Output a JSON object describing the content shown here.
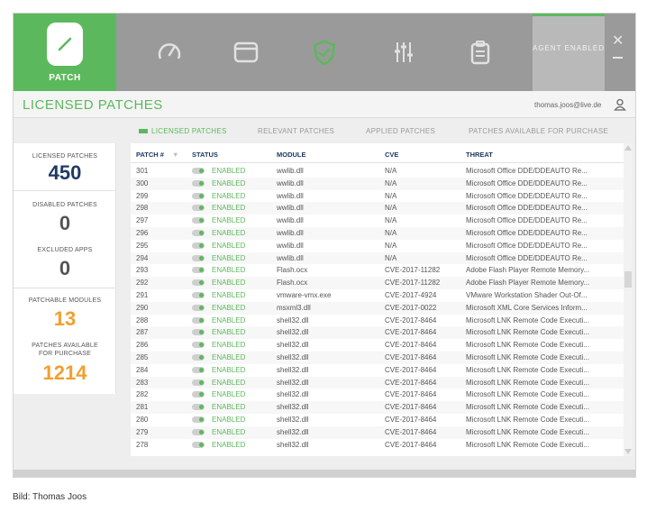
{
  "app": {
    "patch_tab_label": "PATCH",
    "agent_status": "AGENT ENABLED",
    "nav_icons": [
      "gauge-icon",
      "window-icon",
      "shield-check-icon",
      "sliders-icon",
      "clipboard-icon"
    ],
    "accent_color": "#5cb85c"
  },
  "header": {
    "title": "LICENSED PATCHES",
    "user_email": "thomas.joos@live.de"
  },
  "subtabs": [
    "LICENSED PATCHES",
    "RELEVANT PATCHES",
    "APPLIED PATCHES",
    "PATCHES AVAILABLE FOR PURCHASE"
  ],
  "stats": {
    "licensed_patches": {
      "label": "LICENSED PATCHES",
      "value": "450",
      "color": "#1f3a63"
    },
    "disabled_patches": {
      "label": "DISABLED PATCHES",
      "value": "0",
      "color": "#555555"
    },
    "excluded_apps": {
      "label": "EXCLUDED APPS",
      "value": "0",
      "color": "#555555"
    },
    "patchable_modules": {
      "label": "PATCHABLE MODULES",
      "value": "13",
      "color": "#f0a030"
    },
    "patches_for_purchase": {
      "label": "PATCHES AVAILABLE FOR PURCHASE",
      "value": "1214",
      "color": "#f0a030"
    }
  },
  "table": {
    "columns": [
      "PATCH #",
      "STATUS",
      "MODULE",
      "CVE",
      "THREAT"
    ],
    "rows": [
      [
        "301",
        "ENABLED",
        "wwlib.dll",
        "N/A",
        "Microsoft Office DDE/DDEAUTO Re..."
      ],
      [
        "300",
        "ENABLED",
        "wwlib.dll",
        "N/A",
        "Microsoft Office DDE/DDEAUTO Re..."
      ],
      [
        "299",
        "ENABLED",
        "wwlib.dll",
        "N/A",
        "Microsoft Office DDE/DDEAUTO Re..."
      ],
      [
        "298",
        "ENABLED",
        "wwlib.dll",
        "N/A",
        "Microsoft Office DDE/DDEAUTO Re..."
      ],
      [
        "297",
        "ENABLED",
        "wwlib.dll",
        "N/A",
        "Microsoft Office DDE/DDEAUTO Re..."
      ],
      [
        "296",
        "ENABLED",
        "wwlib.dll",
        "N/A",
        "Microsoft Office DDE/DDEAUTO Re..."
      ],
      [
        "295",
        "ENABLED",
        "wwlib.dll",
        "N/A",
        "Microsoft Office DDE/DDEAUTO Re..."
      ],
      [
        "294",
        "ENABLED",
        "wwlib.dll",
        "N/A",
        "Microsoft Office DDE/DDEAUTO Re..."
      ],
      [
        "293",
        "ENABLED",
        "Flash.ocx",
        "CVE-2017-11282",
        "Adobe Flash Player Remote Memory..."
      ],
      [
        "292",
        "ENABLED",
        "Flash.ocx",
        "CVE-2017-11282",
        "Adobe Flash Player Remote Memory..."
      ],
      [
        "291",
        "ENABLED",
        "vmware-vmx.exe",
        "CVE-2017-4924",
        "VMware Workstation Shader Out-Of..."
      ],
      [
        "290",
        "ENABLED",
        "msxml3.dll",
        "CVE-2017-0022",
        "Microsoft XML Core Services Inform..."
      ],
      [
        "288",
        "ENABLED",
        "shell32.dll",
        "CVE-2017-8464",
        "Microsoft LNK Remote Code Executi..."
      ],
      [
        "287",
        "ENABLED",
        "shell32.dll",
        "CVE-2017-8464",
        "Microsoft LNK Remote Code Executi..."
      ],
      [
        "286",
        "ENABLED",
        "shell32.dll",
        "CVE-2017-8464",
        "Microsoft LNK Remote Code Executi..."
      ],
      [
        "285",
        "ENABLED",
        "shell32.dll",
        "CVE-2017-8464",
        "Microsoft LNK Remote Code Executi..."
      ],
      [
        "284",
        "ENABLED",
        "shell32.dll",
        "CVE-2017-8464",
        "Microsoft LNK Remote Code Executi..."
      ],
      [
        "283",
        "ENABLED",
        "shell32.dll",
        "CVE-2017-8464",
        "Microsoft LNK Remote Code Executi..."
      ],
      [
        "282",
        "ENABLED",
        "shell32.dll",
        "CVE-2017-8464",
        "Microsoft LNK Remote Code Executi..."
      ],
      [
        "281",
        "ENABLED",
        "shell32.dll",
        "CVE-2017-8464",
        "Microsoft LNK Remote Code Executi..."
      ],
      [
        "280",
        "ENABLED",
        "shell32.dll",
        "CVE-2017-8464",
        "Microsoft LNK Remote Code Executi..."
      ],
      [
        "279",
        "ENABLED",
        "shell32.dll",
        "CVE-2017-8464",
        "Microsoft LNK Remote Code Executi..."
      ],
      [
        "278",
        "ENABLED",
        "shell32.dll",
        "CVE-2017-8464",
        "Microsoft LNK Remote Code Executi..."
      ]
    ]
  },
  "caption": "Bild: Thomas Joos"
}
